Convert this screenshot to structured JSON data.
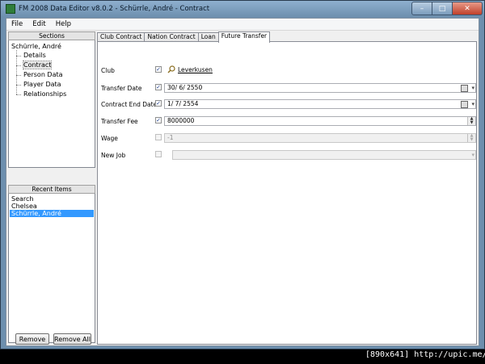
{
  "window": {
    "title": "FM 2008 Data Editor v8.0.2 - Schürrle, André - Contract",
    "min_symbol": "–",
    "max_symbol": "□",
    "close_symbol": "✕"
  },
  "menu": [
    "File",
    "Edit",
    "Help"
  ],
  "sections": {
    "header": "Sections",
    "root": "Schürrle, André",
    "children": [
      "Details",
      "Contract",
      "Person Data",
      "Player Data",
      "Relationships"
    ]
  },
  "recent": {
    "header": "Recent Items",
    "items": [
      "Search",
      "Chelsea",
      "Schürrle, André"
    ]
  },
  "buttons": {
    "remove": "Remove",
    "remove_all": "Remove All"
  },
  "tabs": [
    "Club Contract",
    "Nation Contract",
    "Loan",
    "Future Transfer"
  ],
  "form": {
    "club": {
      "label": "Club",
      "value": "Leverkusen",
      "checked": "✓",
      "icon": "search-icon"
    },
    "transfer_date": {
      "label": "Transfer Date",
      "value": "30/  6/  2550",
      "checked": "✓",
      "icon": "calendar-icon"
    },
    "contract_end": {
      "label": "Contract End Date",
      "value": " 1/  7/  2554",
      "checked": "✓",
      "icon": "calendar-icon"
    },
    "transfer_fee": {
      "label": "Transfer Fee",
      "value": "8000000",
      "checked": "✓"
    },
    "wage": {
      "label": "Wage",
      "value": "-1"
    },
    "new_job": {
      "label": "New Job",
      "value": ""
    }
  },
  "watermark": "[890x641] http://upic.me/"
}
